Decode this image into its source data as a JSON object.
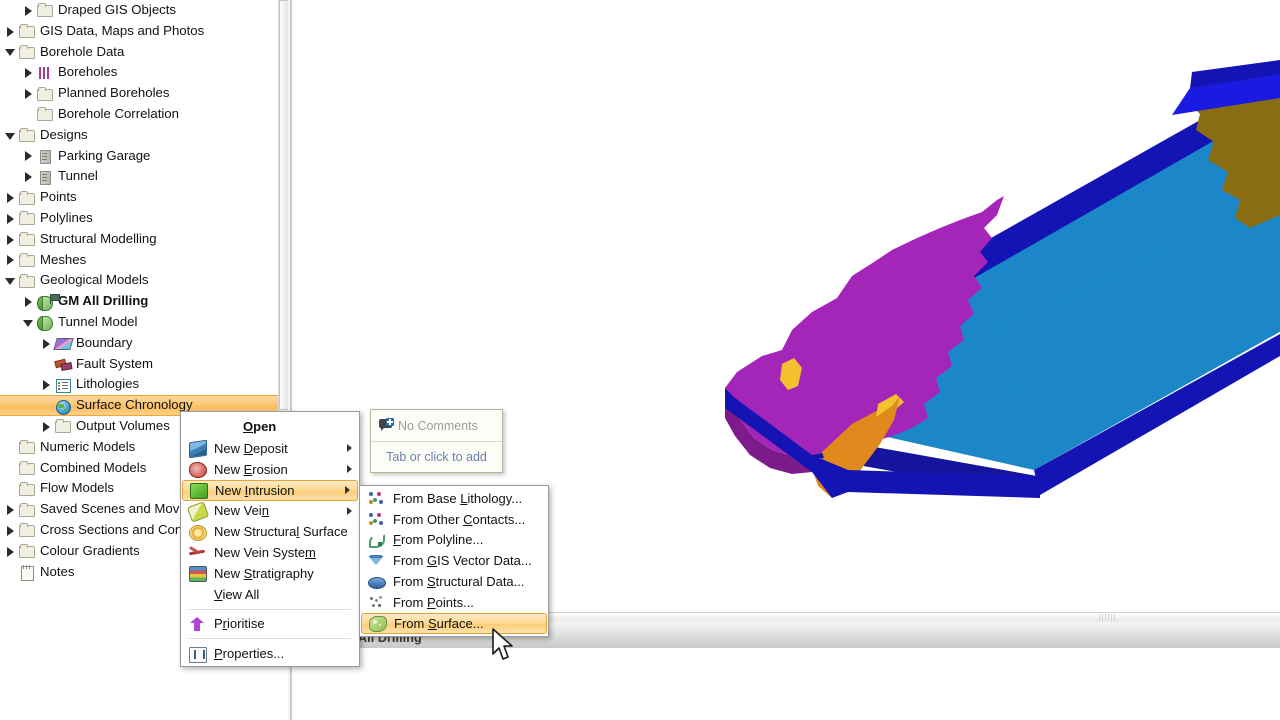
{
  "app": {
    "bottom_tab_label": "All Drilling"
  },
  "tree": {
    "name": "project-tree",
    "items": [
      {
        "label": "Draped GIS Objects",
        "indent": 1,
        "twisty": "closed",
        "icon": "folder-icon"
      },
      {
        "label": "GIS Data, Maps and Photos",
        "indent": 0,
        "twisty": "closed",
        "icon": "folder-icon"
      },
      {
        "label": "Borehole Data",
        "indent": 0,
        "twisty": "open",
        "icon": "folder-icon"
      },
      {
        "label": "Boreholes",
        "indent": 1,
        "twisty": "closed",
        "icon": "boreholes-icon"
      },
      {
        "label": "Planned Boreholes",
        "indent": 1,
        "twisty": "closed",
        "icon": "folder-icon"
      },
      {
        "label": "Borehole Correlation",
        "indent": 1,
        "twisty": "none",
        "icon": "folder-icon"
      },
      {
        "label": "Designs",
        "indent": 0,
        "twisty": "open",
        "icon": "folder-icon"
      },
      {
        "label": "Parking Garage",
        "indent": 1,
        "twisty": "closed",
        "icon": "design-icon"
      },
      {
        "label": "Tunnel",
        "indent": 1,
        "twisty": "closed",
        "icon": "design-icon"
      },
      {
        "label": "Points",
        "indent": 0,
        "twisty": "closed",
        "icon": "folder-icon"
      },
      {
        "label": "Polylines",
        "indent": 0,
        "twisty": "closed",
        "icon": "folder-icon"
      },
      {
        "label": "Structural Modelling",
        "indent": 0,
        "twisty": "closed",
        "icon": "folder-icon"
      },
      {
        "label": "Meshes",
        "indent": 0,
        "twisty": "closed",
        "icon": "folder-icon"
      },
      {
        "label": "Geological Models",
        "indent": 0,
        "twisty": "open",
        "icon": "folder-icon"
      },
      {
        "label": "GM All Drilling",
        "indent": 1,
        "twisty": "closed",
        "icon": "geological-model-icon",
        "bold": true,
        "flag": true
      },
      {
        "label": "Tunnel Model",
        "indent": 1,
        "twisty": "open",
        "icon": "geological-model-icon"
      },
      {
        "label": "Boundary",
        "indent": 2,
        "twisty": "closed",
        "icon": "boundary-icon"
      },
      {
        "label": "Fault System",
        "indent": 2,
        "twisty": "none",
        "icon": "fault-system-icon"
      },
      {
        "label": "Lithologies",
        "indent": 2,
        "twisty": "closed",
        "icon": "lithologies-icon"
      },
      {
        "label": "Surface Chronology",
        "indent": 2,
        "twisty": "none",
        "icon": "surface-chronology-icon",
        "selected": true
      },
      {
        "label": "Output Volumes",
        "indent": 2,
        "twisty": "closed",
        "icon": "folder-icon"
      },
      {
        "label": "Numeric Models",
        "indent": 0,
        "twisty": "none",
        "icon": "folder-icon"
      },
      {
        "label": "Combined Models",
        "indent": 0,
        "twisty": "none",
        "icon": "folder-icon"
      },
      {
        "label": "Flow Models",
        "indent": 0,
        "twisty": "none",
        "icon": "folder-icon"
      },
      {
        "label": "Saved Scenes and Movies",
        "indent": 0,
        "twisty": "closed",
        "icon": "folder-icon"
      },
      {
        "label": "Cross Sections and Contours",
        "indent": 0,
        "twisty": "closed",
        "icon": "folder-icon"
      },
      {
        "label": "Colour Gradients",
        "indent": 0,
        "twisty": "closed",
        "icon": "folder-icon"
      },
      {
        "label": "Notes",
        "indent": 0,
        "twisty": "none",
        "icon": "notes-icon"
      }
    ]
  },
  "comments_popup": {
    "title": "No Comments",
    "hint": "Tab or click to add",
    "icon": "comment-icon"
  },
  "context_menu": {
    "items": [
      {
        "label": "Open",
        "type": "header",
        "accel": "O"
      },
      {
        "label": "New Deposit",
        "icon": "deposit-icon",
        "accel": "D",
        "submenu": true
      },
      {
        "label": "New Erosion",
        "icon": "erosion-icon",
        "accel": "E",
        "submenu": true
      },
      {
        "label": "New Intrusion",
        "icon": "intrusion-icon",
        "accel": "I",
        "submenu": true,
        "highlighted": true
      },
      {
        "label": "New Vein",
        "icon": "vein-icon",
        "accel": "n",
        "submenu": true
      },
      {
        "label": "New Structural Surface",
        "icon": "structural-surface-icon",
        "accel": "l"
      },
      {
        "label": "New Vein System",
        "icon": "vein-system-icon",
        "accel": "m"
      },
      {
        "label": "New Stratigraphy",
        "icon": "stratigraphy-icon",
        "accel": "S"
      },
      {
        "label": "View All",
        "icon": "none",
        "accel": "V"
      },
      {
        "type": "separator"
      },
      {
        "label": "Prioritise",
        "icon": "prioritise-icon",
        "accel": "r"
      },
      {
        "type": "separator"
      },
      {
        "label": "Properties...",
        "icon": "properties-icon",
        "accel": "P"
      }
    ]
  },
  "sub_menu": {
    "items": [
      {
        "label": "From Base Lithology...",
        "icon": "base-lithology-icon",
        "accel": "L"
      },
      {
        "label": "From Other Contacts...",
        "icon": "other-contacts-icon",
        "accel": "C"
      },
      {
        "label": "From Polyline...",
        "icon": "polyline-icon",
        "accel": "F"
      },
      {
        "label": "From GIS Vector Data...",
        "icon": "gis-vector-icon",
        "accel": "G"
      },
      {
        "label": "From Structural Data...",
        "icon": "structural-data-icon",
        "accel": "S"
      },
      {
        "label": "From Points...",
        "icon": "points-icon",
        "accel": "P"
      },
      {
        "label": "From Surface...",
        "icon": "surface-icon",
        "accel": "S",
        "highlighted": true
      }
    ]
  },
  "scene": {
    "name": "3d-geological-model-view",
    "colors": {
      "top_blue": "#1b87c9",
      "side_blue": "#1414b4",
      "purple": "#a426b8",
      "purple_dark": "#7d1a8c",
      "olive": "#8a6d12",
      "orange": "#e08a1e",
      "yellow": "#f2c12e",
      "background": "#ffffff"
    }
  }
}
